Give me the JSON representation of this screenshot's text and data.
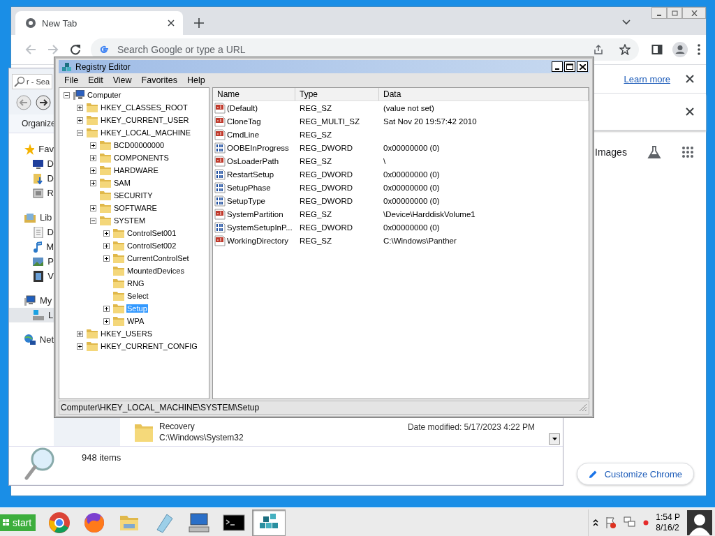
{
  "chrome": {
    "tabs": [
      {
        "label": "New Tab",
        "selected": true
      }
    ],
    "address": {
      "placeholder": "Search Google or type a URL"
    },
    "learn_more": "Learn more",
    "images_link": "Images",
    "customize_button": "Customize Chrome"
  },
  "explorer": {
    "search_placeholder": "r - Sea",
    "toolbar_label": "Organize",
    "nav_items": [
      {
        "label": "Fav",
        "kind": "group",
        "selected": false
      },
      {
        "label": "D",
        "kind": "item",
        "selected": false
      },
      {
        "label": "D",
        "kind": "item",
        "selected": false
      },
      {
        "label": "R",
        "kind": "item",
        "selected": false
      },
      {
        "label": "Lib",
        "kind": "group",
        "selected": false
      },
      {
        "label": "D",
        "kind": "item",
        "selected": false
      },
      {
        "label": "M",
        "kind": "item",
        "selected": false
      },
      {
        "label": "P",
        "kind": "item",
        "selected": false
      },
      {
        "label": "V",
        "kind": "item",
        "selected": false
      },
      {
        "label": "My",
        "kind": "group",
        "selected": false
      },
      {
        "label": "L",
        "kind": "item",
        "selected": true
      },
      {
        "label": "Net",
        "kind": "group",
        "selected": false
      }
    ],
    "file": {
      "name": "Recovery",
      "path": "C:\\Windows\\System32",
      "modified": "Date modified: 5/17/2023 4:22 PM"
    },
    "status": "948 items"
  },
  "regedit": {
    "title": "Registry Editor",
    "menu": [
      "File",
      "Edit",
      "View",
      "Favorites",
      "Help"
    ],
    "tree": [
      {
        "label": "Computer",
        "kind": "computer",
        "expanded": true,
        "has_children": true,
        "selected": false,
        "children": [
          {
            "label": "HKEY_CLASSES_ROOT",
            "kind": "folder",
            "expanded": false,
            "has_children": true,
            "selected": false
          },
          {
            "label": "HKEY_CURRENT_USER",
            "kind": "folder",
            "expanded": false,
            "has_children": true,
            "selected": false
          },
          {
            "label": "HKEY_LOCAL_MACHINE",
            "kind": "folder",
            "expanded": true,
            "has_children": true,
            "selected": false,
            "children": [
              {
                "label": "BCD00000000",
                "kind": "folder",
                "expanded": false,
                "has_children": true,
                "selected": false
              },
              {
                "label": "COMPONENTS",
                "kind": "folder",
                "expanded": false,
                "has_children": true,
                "selected": false
              },
              {
                "label": "HARDWARE",
                "kind": "folder",
                "expanded": false,
                "has_children": true,
                "selected": false
              },
              {
                "label": "SAM",
                "kind": "folder",
                "expanded": false,
                "has_children": true,
                "selected": false
              },
              {
                "label": "SECURITY",
                "kind": "folder",
                "expanded": false,
                "has_children": false,
                "selected": false
              },
              {
                "label": "SOFTWARE",
                "kind": "folder",
                "expanded": false,
                "has_children": true,
                "selected": false
              },
              {
                "label": "SYSTEM",
                "kind": "folder",
                "expanded": true,
                "has_children": true,
                "selected": false,
                "children": [
                  {
                    "label": "ControlSet001",
                    "kind": "folder",
                    "expanded": false,
                    "has_children": true,
                    "selected": false
                  },
                  {
                    "label": "ControlSet002",
                    "kind": "folder",
                    "expanded": false,
                    "has_children": true,
                    "selected": false
                  },
                  {
                    "label": "CurrentControlSet",
                    "kind": "folder",
                    "expanded": false,
                    "has_children": true,
                    "selected": false
                  },
                  {
                    "label": "MountedDevices",
                    "kind": "folder",
                    "expanded": false,
                    "has_children": false,
                    "selected": false
                  },
                  {
                    "label": "RNG",
                    "kind": "folder",
                    "expanded": false,
                    "has_children": false,
                    "selected": false
                  },
                  {
                    "label": "Select",
                    "kind": "folder",
                    "expanded": false,
                    "has_children": false,
                    "selected": false
                  },
                  {
                    "label": "Setup",
                    "kind": "folder",
                    "expanded": false,
                    "has_children": true,
                    "selected": true
                  },
                  {
                    "label": "WPA",
                    "kind": "folder",
                    "expanded": false,
                    "has_children": true,
                    "selected": false
                  }
                ]
              }
            ]
          },
          {
            "label": "HKEY_USERS",
            "kind": "folder",
            "expanded": false,
            "has_children": true,
            "selected": false
          },
          {
            "label": "HKEY_CURRENT_CONFIG",
            "kind": "folder",
            "expanded": false,
            "has_children": true,
            "selected": false
          }
        ]
      }
    ],
    "columns": [
      "Name",
      "Type",
      "Data"
    ],
    "values": [
      {
        "name": "(Default)",
        "type": "REG_SZ",
        "data": "(value not set)",
        "kind": "string"
      },
      {
        "name": "CloneTag",
        "type": "REG_MULTI_SZ",
        "data": "Sat Nov 20 19:57:42 2010",
        "kind": "string"
      },
      {
        "name": "CmdLine",
        "type": "REG_SZ",
        "kind": "string"
      },
      {
        "name": "OOBEInProgress",
        "type": "REG_DWORD",
        "data": "0x00000000 (0)",
        "kind": "binary"
      },
      {
        "name": "OsLoaderPath",
        "type": "REG_SZ",
        "data": "\\",
        "kind": "string"
      },
      {
        "name": "RestartSetup",
        "type": "REG_DWORD",
        "data": "0x00000000 (0)",
        "kind": "binary"
      },
      {
        "name": "SetupPhase",
        "type": "REG_DWORD",
        "data": "0x00000000 (0)",
        "kind": "binary"
      },
      {
        "name": "SetupType",
        "type": "REG_DWORD",
        "data": "0x00000000 (0)",
        "kind": "binary"
      },
      {
        "name": "SystemPartition",
        "type": "REG_SZ",
        "data": "\\Device\\HarddiskVolume1",
        "kind": "string"
      },
      {
        "name": "SystemSetupInP...",
        "type": "REG_DWORD",
        "data": "0x00000000 (0)",
        "kind": "binary"
      },
      {
        "name": "WorkingDirectory",
        "type": "REG_SZ",
        "data": "C:\\Windows\\Panther",
        "kind": "string"
      }
    ],
    "status_bar": "Computer\\HKEY_LOCAL_MACHINE\\SYSTEM\\Setup"
  },
  "taskbar": {
    "start": "start",
    "apps": [
      {
        "selected": false
      },
      {
        "selected": false
      },
      {
        "selected": false
      },
      {
        "selected": false
      },
      {
        "selected": false
      },
      {
        "selected": false
      },
      {
        "selected": true
      }
    ],
    "clock": {
      "time": "1:54 P",
      "date": "8/16/2"
    }
  }
}
